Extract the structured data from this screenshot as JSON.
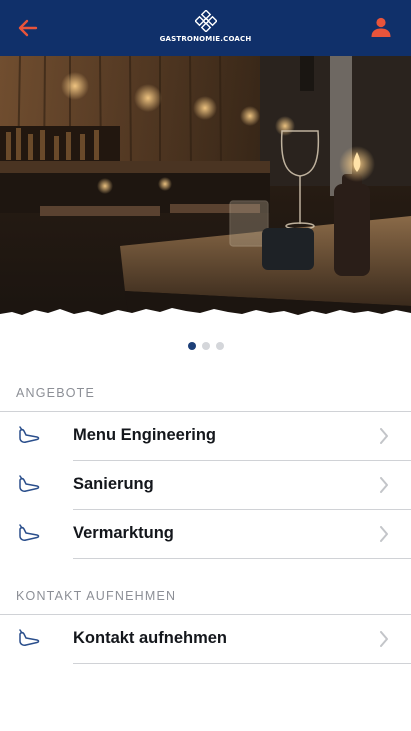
{
  "header": {
    "back_icon": "arrow-left-icon",
    "logo_icon": "gastronomie-coach-logo-icon",
    "logo_text": "GASTRONOMIE.COACH",
    "profile_icon": "user-icon",
    "background": "#10306a",
    "accent": "#e8543b"
  },
  "hero": {
    "image": "restaurant-interior-photo",
    "carousel": {
      "total_slides": 3,
      "active_index": 0
    }
  },
  "offers": {
    "title": "ANGEBOTE",
    "items": [
      {
        "label": "Menu Engineering",
        "icon": "pointer-hand-icon"
      },
      {
        "label": "Sanierung",
        "icon": "pointer-hand-icon"
      },
      {
        "label": "Vermarktung",
        "icon": "pointer-hand-icon"
      }
    ]
  },
  "contact": {
    "title": "KONTAKT AUFNEHMEN",
    "items": [
      {
        "label": "Kontakt aufnehmen",
        "icon": "pointer-hand-icon"
      }
    ]
  }
}
